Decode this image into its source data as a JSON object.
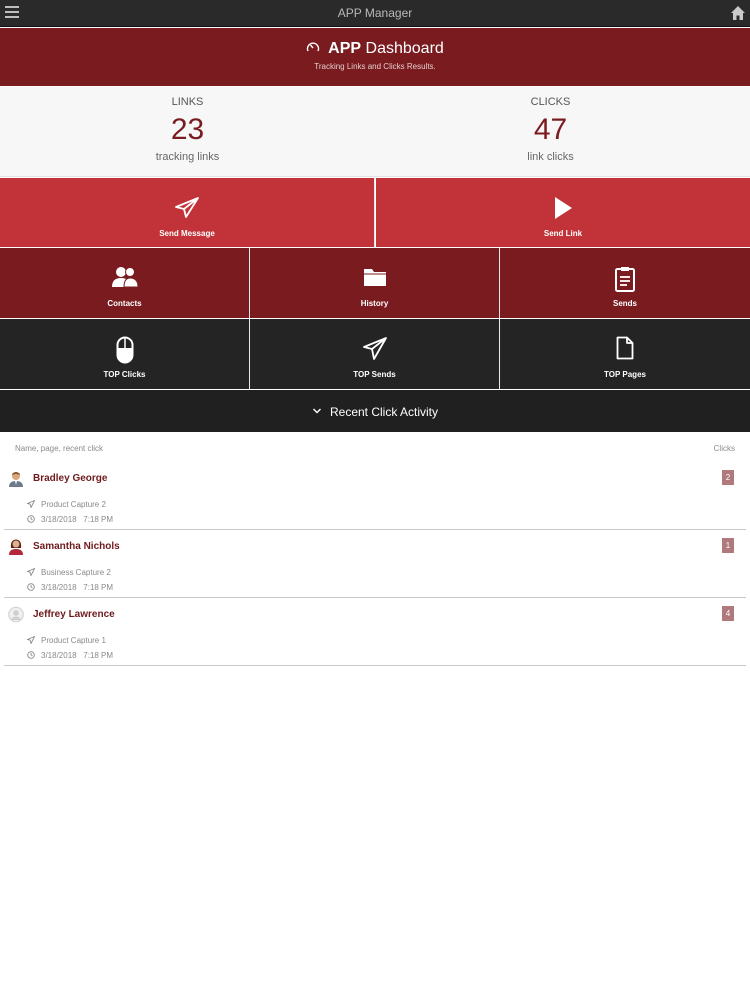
{
  "topbar": {
    "title": "APP Manager",
    "menu_icon": "hamburger-icon",
    "home_icon": "home-icon"
  },
  "header": {
    "title_bold": "APP",
    "title_rest": "Dashboard",
    "subtitle": "Tracking Links and Clicks Results.",
    "icon": "gauge-icon"
  },
  "stats": {
    "links": {
      "label": "LINKS",
      "value": "23",
      "sub": "tracking links"
    },
    "clicks": {
      "label": "CLICKS",
      "value": "47",
      "sub": "link clicks"
    }
  },
  "tiles": {
    "send_message": "Send Message",
    "send_link": "Send Link",
    "contacts": "Contacts",
    "history": "History",
    "sends": "Sends",
    "top_clicks": "TOP Clicks",
    "top_sends": "TOP Sends",
    "top_pages": "TOP Pages"
  },
  "recent": {
    "label": "Recent Click Activity"
  },
  "list": {
    "head_left": "Name, page, recent click",
    "head_right": "Clicks",
    "items": [
      {
        "name": "Bradley George",
        "page": "Product Capture 2",
        "date": "3/18/2018",
        "time": "7:18 PM",
        "clicks": "2"
      },
      {
        "name": "Samantha Nichols",
        "page": "Business Capture 2",
        "date": "3/18/2018",
        "time": "7:18 PM",
        "clicks": "1"
      },
      {
        "name": "Jeffrey Lawrence",
        "page": "Product Capture 1",
        "date": "3/18/2018",
        "time": "7:18 PM",
        "clicks": "4"
      }
    ]
  },
  "colors": {
    "maroon": "#7a1c1f",
    "red": "#c13338",
    "dark": "#242424",
    "badge": "#b07a7c"
  }
}
